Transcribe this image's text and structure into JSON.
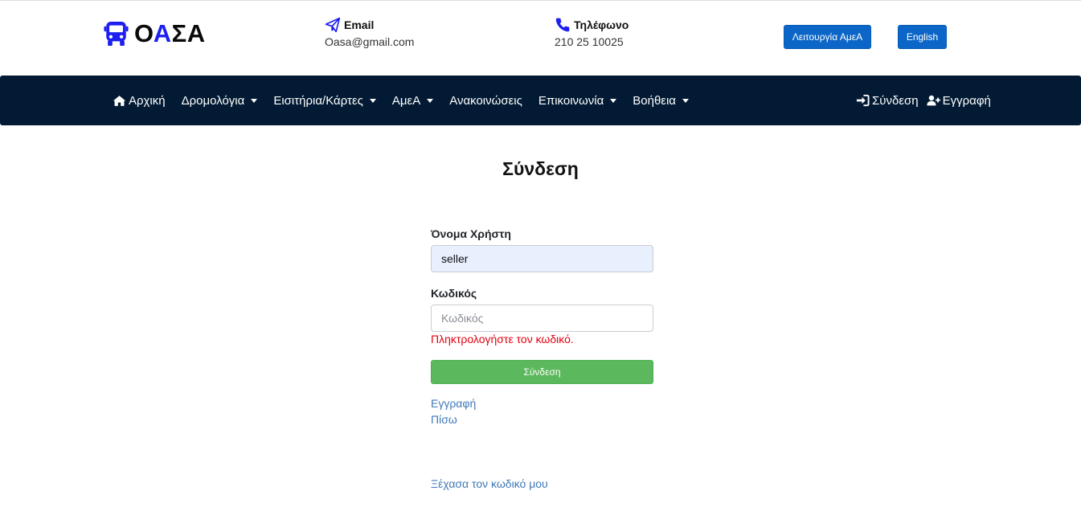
{
  "brand": {
    "logo_text_part1": "Ο",
    "logo_text_accent": "Α",
    "logo_text_part2": "ΣΑ",
    "accent_color": "#1c1ff0"
  },
  "header": {
    "email_label": "Email",
    "email_value": "Oasa@gmail.com",
    "phone_label": "Τηλέφωνο",
    "phone_value": "210 25 10025",
    "amea_button": "Λειτουργία ΑμεΑ",
    "language_button": "English"
  },
  "nav": {
    "items": [
      {
        "label": "Αρχική",
        "icon": "home-icon",
        "dropdown": false
      },
      {
        "label": "Δρομολόγια",
        "dropdown": true
      },
      {
        "label": "Εισιτήρια/Κάρτες",
        "dropdown": true
      },
      {
        "label": "ΑμεΑ",
        "dropdown": true
      },
      {
        "label": "Ανακοινώσεις",
        "dropdown": false
      },
      {
        "label": "Επικοινωνία",
        "dropdown": true
      },
      {
        "label": "Βοήθεια",
        "dropdown": true
      }
    ],
    "login": "Σύνδεση",
    "register": "Εγγραφή",
    "background": "#021a33"
  },
  "page": {
    "title": "Σύνδεση"
  },
  "form": {
    "username_label": "Όνομα Χρήστη",
    "username_value": "seller",
    "password_label": "Κωδικός",
    "password_placeholder": "Κωδικός",
    "password_error": "Πληκτρολογήστε τον κωδικό.",
    "submit_label": "Σύνδεση",
    "submit_color": "#5cb85c"
  },
  "links": {
    "register": "Εγγραφή",
    "back": "Πίσω",
    "forgot": "Ξέχασα τον κωδικό μου"
  }
}
